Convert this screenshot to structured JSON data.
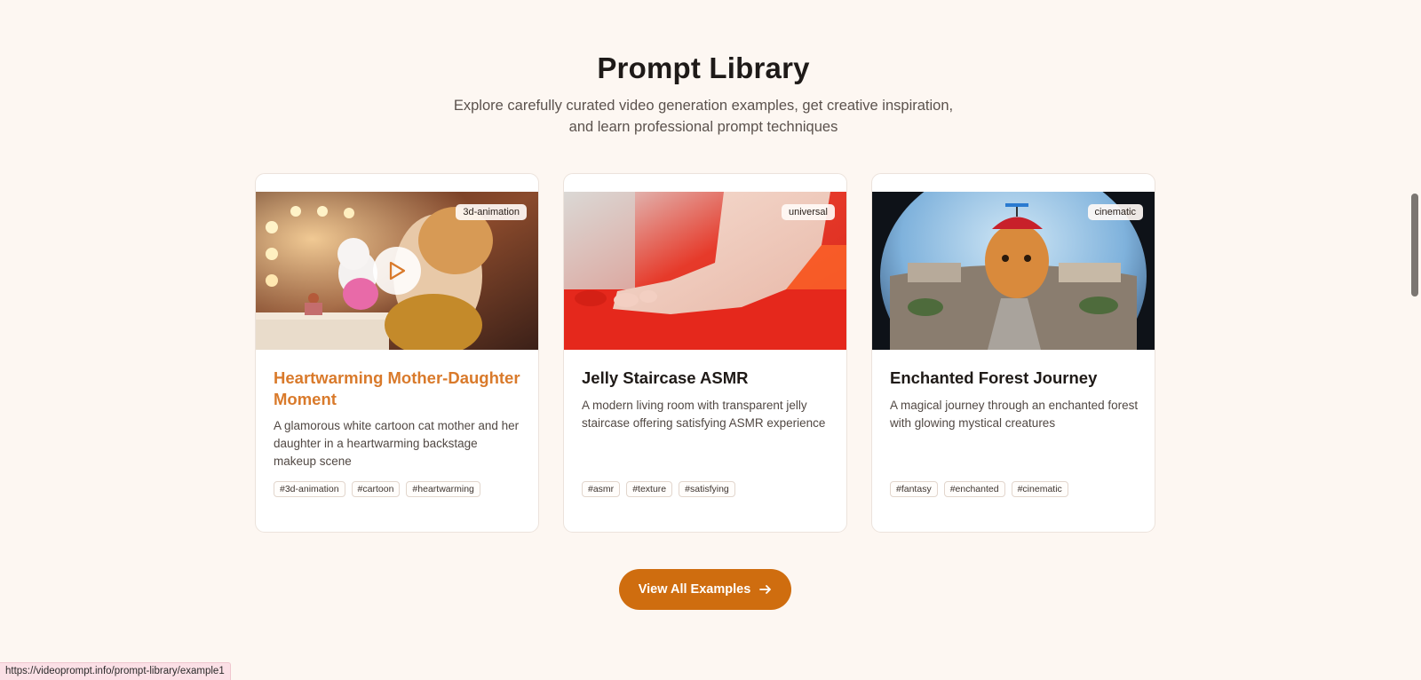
{
  "section": {
    "title": "Prompt Library",
    "subtitle_line1": "Explore carefully curated video generation examples, get creative inspiration,",
    "subtitle_line2": "and learn professional prompt techniques"
  },
  "cards": [
    {
      "category": "3d-animation",
      "title": "Heartwarming Mother-Daughter Moment",
      "description": "A glamorous white cartoon cat mother and her daughter in a heartwarming backstage makeup scene",
      "tags": [
        "#3d-animation",
        "#cartoon",
        "#heartwarming"
      ],
      "play_icon": "play-icon"
    },
    {
      "category": "universal",
      "title": "Jelly Staircase ASMR",
      "description": "A modern living room with transparent jelly staircase offering satisfying ASMR experience",
      "tags": [
        "#asmr",
        "#texture",
        "#satisfying"
      ]
    },
    {
      "category": "cinematic",
      "title": "Enchanted Forest Journey",
      "description": "A magical journey through an enchanted forest with glowing mystical creatures",
      "tags": [
        "#fantasy",
        "#enchanted",
        "#cinematic"
      ]
    }
  ],
  "cta": {
    "label": "View All Examples",
    "icon": "arrow-right-icon"
  },
  "status_bar": {
    "url": "https://videoprompt.info/prompt-library/example1"
  },
  "colors": {
    "accent": "#cf6d0f",
    "active_title": "#d97a2b",
    "background": "#fdf7f2"
  }
}
